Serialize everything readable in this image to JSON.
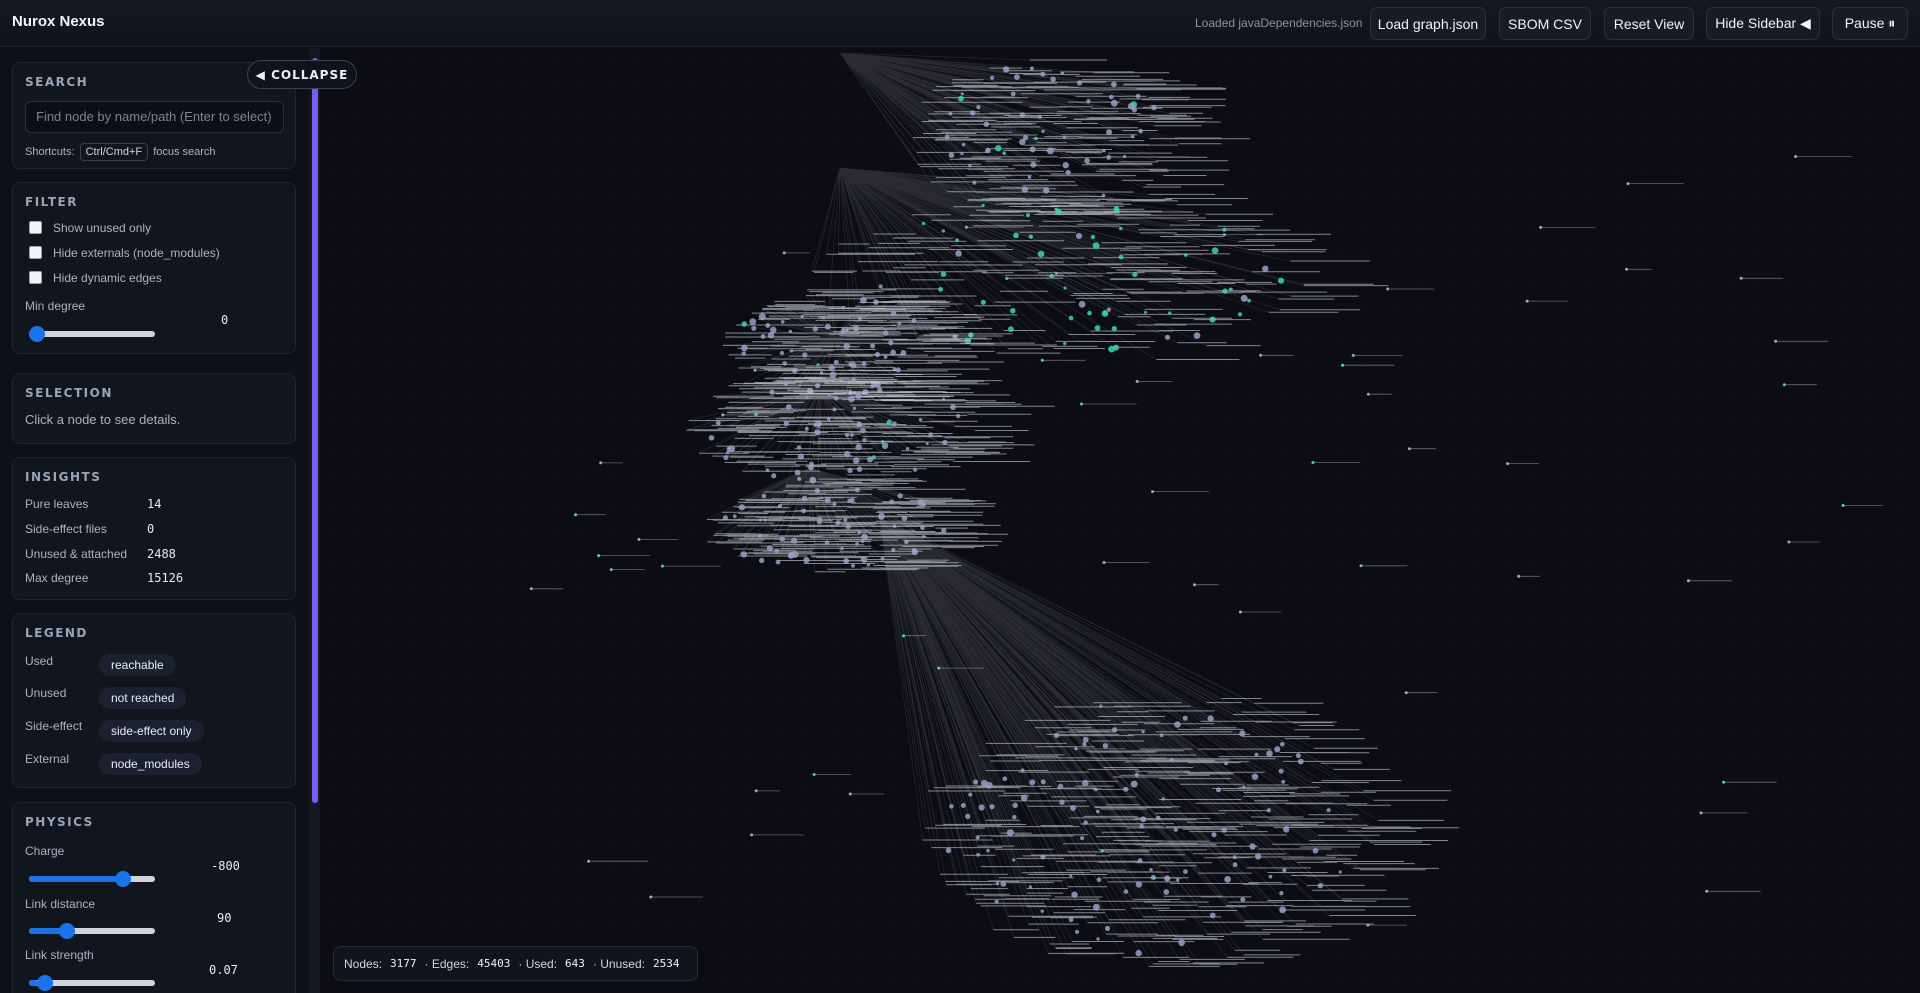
{
  "app": {
    "title": "Nurox Nexus",
    "status": "Loaded javaDependencies.json"
  },
  "toolbar": {
    "load_label": "Load graph.json",
    "sbom_label": "SBOM CSV",
    "reset_label": "Reset View",
    "hide_sidebar_label": "Hide Sidebar ◀",
    "pause_label": "Pause ⏸"
  },
  "collapse_label": "◀ COLLAPSE",
  "search": {
    "title": "SEARCH",
    "placeholder": "Find node by name/path (Enter to select)",
    "shortcuts_label": "Shortcuts:",
    "shortcut_key": "Ctrl/Cmd+F",
    "shortcut_desc": "focus search"
  },
  "filter": {
    "title": "FILTER",
    "options": [
      "Show unused only",
      "Hide externals (node_modules)",
      "Hide dynamic edges"
    ],
    "min_degree_label": "Min degree",
    "min_degree_value": "0",
    "min_degree_fraction": 0.0
  },
  "selection": {
    "title": "SELECTION",
    "hint": "Click a node to see details."
  },
  "insights": {
    "title": "INSIGHTS",
    "rows": [
      {
        "label": "Pure leaves",
        "value": "14"
      },
      {
        "label": "Side-effect files",
        "value": "0"
      },
      {
        "label": "Unused & attached",
        "value": "2488"
      },
      {
        "label": "Max degree",
        "value": "15126"
      }
    ]
  },
  "legend": {
    "title": "LEGEND",
    "rows": [
      {
        "label": "Used",
        "chip": "reachable"
      },
      {
        "label": "Unused",
        "chip": "not reached"
      },
      {
        "label": "Side-effect",
        "chip": "side-effect only"
      },
      {
        "label": "External",
        "chip": "node_modules"
      }
    ]
  },
  "physics": {
    "title": "PHYSICS",
    "charge_label": "Charge",
    "charge_value": "-800",
    "charge_fraction": 0.78,
    "distance_label": "Link distance",
    "distance_value": "90",
    "distance_fraction": 0.27,
    "strength_label": "Link strength",
    "strength_value": "0.07",
    "strength_fraction": 0.07
  },
  "stats": {
    "nodes_label": "Nodes:",
    "nodes": "3177",
    "edges_label": "· Edges:",
    "edges": "45403",
    "used_label": "· Used:",
    "used": "643",
    "unused_label": "· Unused:",
    "unused": "2534"
  },
  "colors": {
    "accent": "#1a73e8",
    "used_node": "#3dd6b0",
    "unused_node": "#9aa0c8",
    "scroll": "#7b5cf0"
  }
}
